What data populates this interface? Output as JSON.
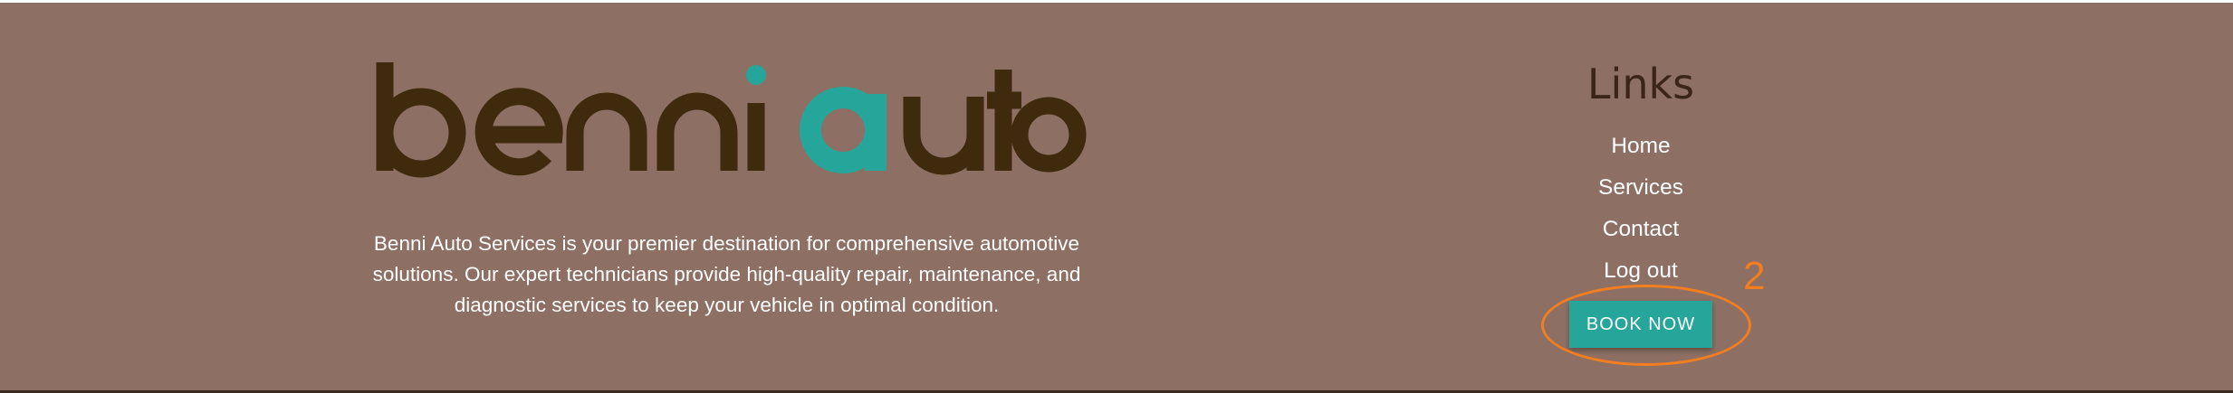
{
  "brand": {
    "logo_part1": "benni",
    "logo_part2": "auto",
    "logo_color_dark": "#3f2a0d",
    "logo_color_accent": "#26a69a"
  },
  "footer": {
    "description": "Benni Auto Services is your premier destination for comprehensive automotive solutions. Our expert technicians provide high-quality repair, maintenance, and diagnostic services to keep your vehicle in optimal condition.",
    "links_title": "Links",
    "links": [
      {
        "label": "Home"
      },
      {
        "label": "Services"
      },
      {
        "label": "Contact"
      },
      {
        "label": "Log out"
      }
    ],
    "book_button_label": "BOOK NOW"
  },
  "annotation": {
    "number": "2",
    "color": "#f27e1f"
  },
  "colors": {
    "background": "#8d6f64",
    "button": "#26a69a",
    "title": "#3d2418"
  }
}
